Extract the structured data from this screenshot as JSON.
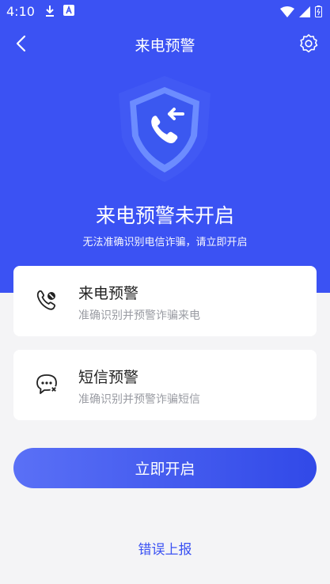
{
  "status_bar": {
    "time": "4:10"
  },
  "header": {
    "title": "来电预警"
  },
  "hero": {
    "title": "来电预警未开启",
    "subtitle": "无法准确识别电信诈骗，请立即开启"
  },
  "cards": [
    {
      "title": "来电预警",
      "desc": "准确识别并预警诈骗来电",
      "icon": "phone-shield-icon"
    },
    {
      "title": "短信预警",
      "desc": "准确识别并预警诈骗短信",
      "icon": "chat-bubble-icon"
    }
  ],
  "cta": {
    "label": "立即开启"
  },
  "report": {
    "label": "错误上报"
  },
  "colors": {
    "primary": "#3b52f3",
    "background": "#f4f4f6"
  }
}
